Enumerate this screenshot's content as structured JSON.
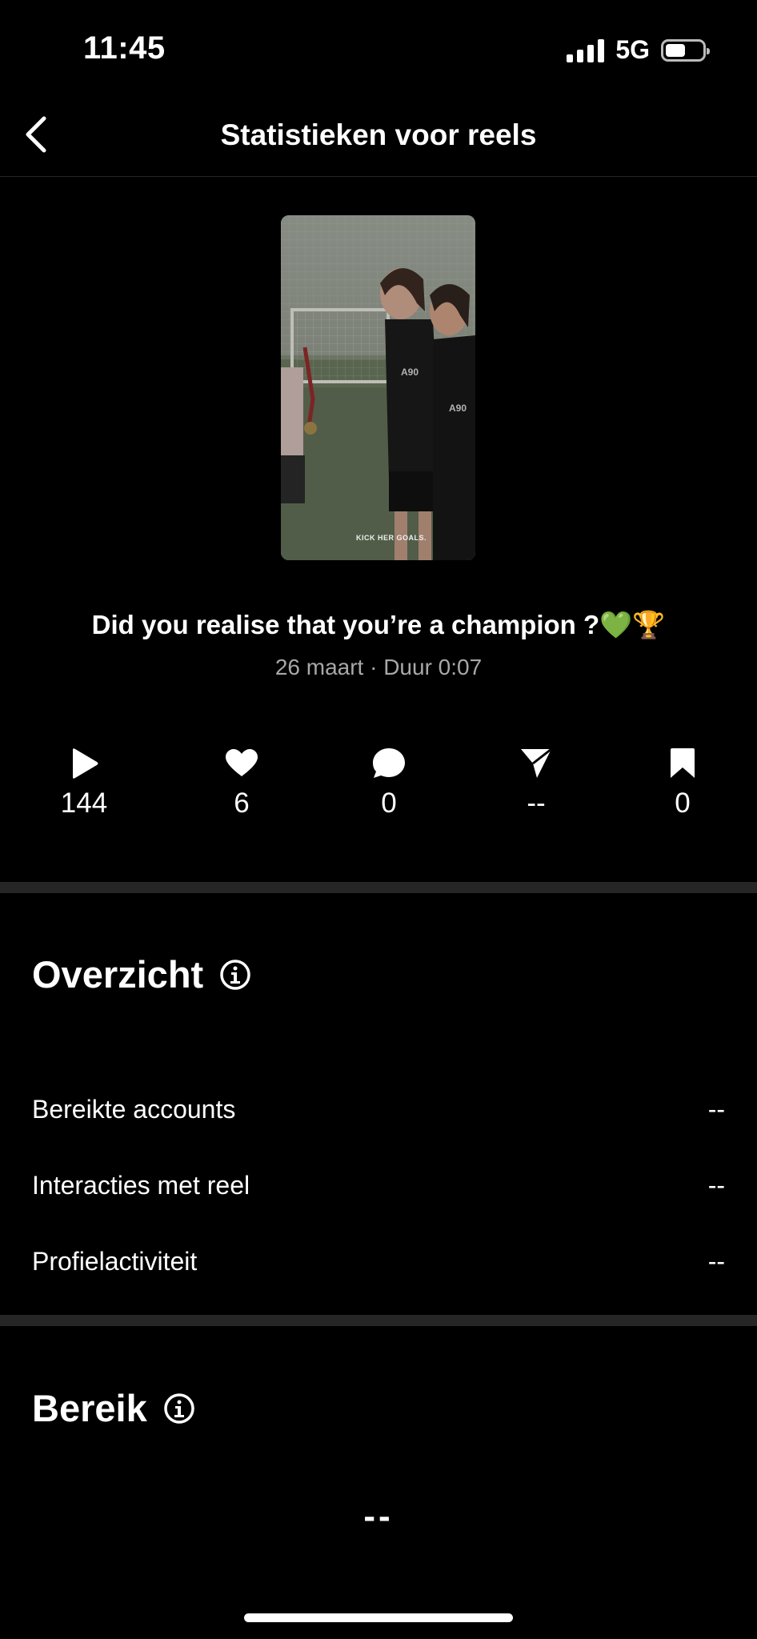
{
  "status_bar": {
    "time": "11:45",
    "network": "5G",
    "battery_level": 0.55
  },
  "header": {
    "title": "Statistieken voor reels",
    "back_icon": "chevron-left-icon"
  },
  "reel": {
    "thumbnail_text": "KICK HER GOALS.",
    "caption": "Did you realise that you’re a champion ?💚🏆",
    "meta": "26 maart · Duur 0:07"
  },
  "stats": [
    {
      "icon": "play-icon",
      "value": "144"
    },
    {
      "icon": "heart-icon",
      "value": "6"
    },
    {
      "icon": "comment-icon",
      "value": "0"
    },
    {
      "icon": "share-icon",
      "value": "--"
    },
    {
      "icon": "bookmark-icon",
      "value": "0"
    }
  ],
  "overview": {
    "title": "Overzicht",
    "rows": [
      {
        "label": "Bereikte accounts",
        "value": "--"
      },
      {
        "label": "Interacties met reel",
        "value": "--"
      },
      {
        "label": "Profielactiviteit",
        "value": "--"
      }
    ]
  },
  "reach": {
    "title": "Bereik",
    "value": "--"
  }
}
